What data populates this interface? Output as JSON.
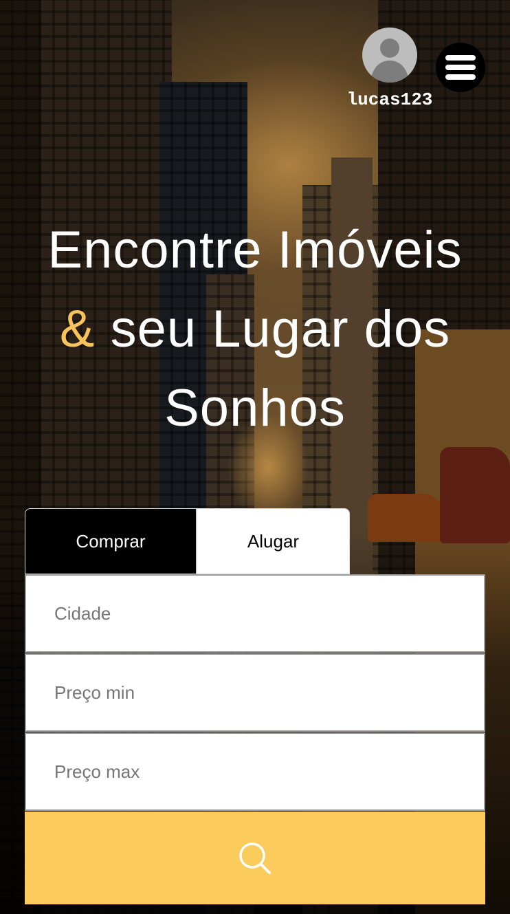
{
  "header": {
    "username": "lucas123",
    "avatar_icon": "user-avatar-icon",
    "menu_icon": "hamburger-menu-icon"
  },
  "hero": {
    "line1": "Encontre Imóveis",
    "ampersand": "&",
    "line2": " seu Lugar dos",
    "line3": "Sonhos",
    "accent_color": "#f7c35a"
  },
  "search_form": {
    "tabs": [
      {
        "label": "Comprar",
        "selected": true
      },
      {
        "label": "Alugar",
        "selected": false
      }
    ],
    "city_placeholder": "Cidade",
    "min_price_placeholder": "Preço min",
    "max_price_placeholder": "Preço max",
    "search_icon": "search-icon",
    "button_color": "#fbcb5c"
  }
}
